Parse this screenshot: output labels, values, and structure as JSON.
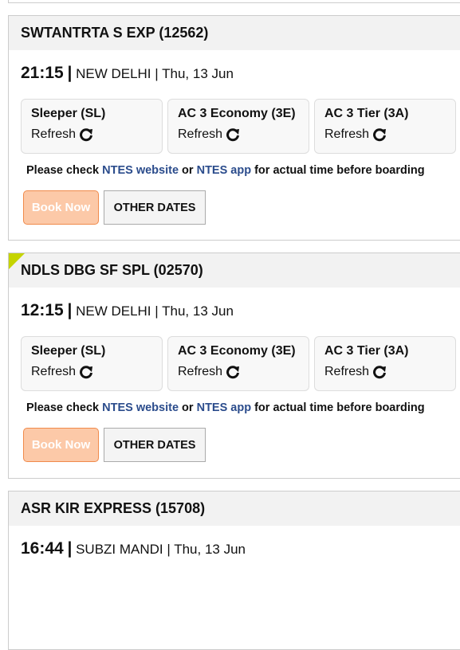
{
  "trains": [
    {
      "name": "SWTANTRTA S EXP (12562)",
      "time": "21:15",
      "station": "NEW DELHI",
      "date": "Thu, 13 Jun",
      "classes": [
        {
          "name": "Sleeper (SL)",
          "action": "Refresh"
        },
        {
          "name": "AC 3 Economy (3E)",
          "action": "Refresh"
        },
        {
          "name": "AC 3 Tier (3A)",
          "action": "Refresh"
        }
      ]
    },
    {
      "name": "NDLS DBG SF SPL (02570)",
      "time": "12:15",
      "station": "NEW DELHI",
      "date": "Thu, 13 Jun",
      "classes": [
        {
          "name": "Sleeper (SL)",
          "action": "Refresh"
        },
        {
          "name": "AC 3 Economy (3E)",
          "action": "Refresh"
        },
        {
          "name": "AC 3 Tier (3A)",
          "action": "Refresh"
        }
      ]
    },
    {
      "name": "ASR KIR EXPRESS (15708)",
      "time": "16:44",
      "station": "SUBZI MANDI",
      "date": "Thu, 13 Jun"
    }
  ],
  "note": {
    "prefix": "Please check ",
    "link1": "NTES website",
    "mid": " or ",
    "link2": "NTES app",
    "suffix": " for actual time before boarding"
  },
  "buttons": {
    "book": "Book Now",
    "other": "OTHER DATES"
  },
  "sep": "|"
}
